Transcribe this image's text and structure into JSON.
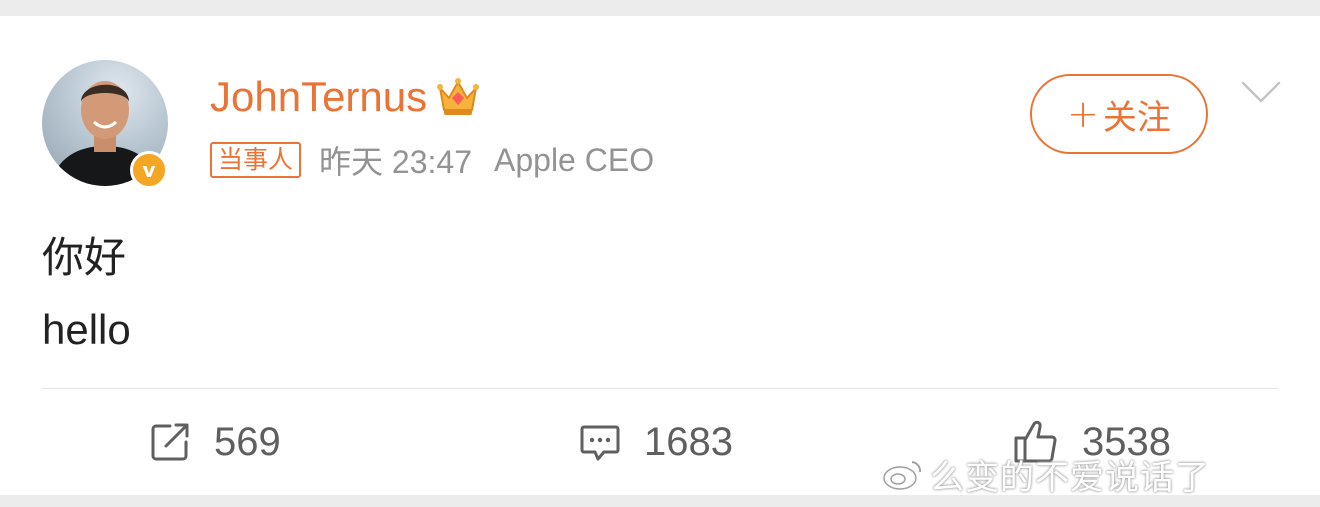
{
  "post": {
    "user": {
      "name": "JohnTernus",
      "verified_badge": "v",
      "member_icon": "crown-icon"
    },
    "meta": {
      "tag": "当事人",
      "time": "昨天 23:47",
      "source": "Apple CEO"
    },
    "follow_button": {
      "label": "关注",
      "plus": "+"
    },
    "content": {
      "line1": "你好",
      "line2": "hello"
    },
    "actions": {
      "repost_count": "569",
      "comment_count": "1683",
      "like_count": "3538"
    }
  },
  "watermark": {
    "text": "么变的不爱说话了"
  },
  "colors": {
    "accent": "#eb7336",
    "verified": "#f5a623",
    "meta_gray": "#939393",
    "action_gray": "#5f5f5f"
  }
}
